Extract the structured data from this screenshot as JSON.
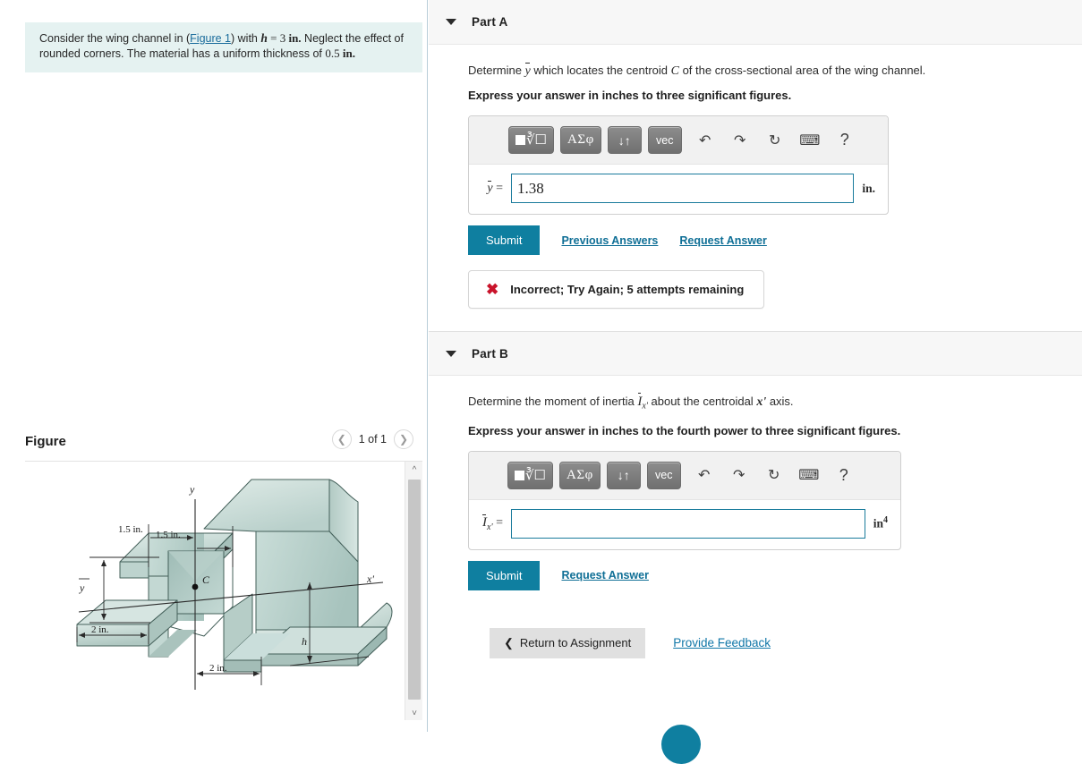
{
  "problem": {
    "text_before_link": "Consider the wing channel in (",
    "figure_link": "Figure 1",
    "text_after_link": ") with ",
    "h_symbol": "h",
    "h_value": " = 3 ",
    "h_unit": "in.",
    "text_mid": " Neglect the effect of rounded corners. The material has a uniform thickness of ",
    "thickness_value": "0.5 ",
    "thickness_unit": "in."
  },
  "figure_panel": {
    "title": "Figure",
    "counter": "1 of 1",
    "prev_icon": "chevron-left-icon",
    "next_icon": "chevron-right-icon",
    "labels": {
      "y_axis": "y",
      "x_prime_axis": "x'",
      "centroid": "C",
      "y_bar": "y",
      "h": "h",
      "dim_1": "1.5 in.",
      "dim_2": "1.5 in.",
      "dim_3": "2 in.",
      "dim_4": "2 in."
    },
    "colors": {
      "body_light": "#d3e3de",
      "body_mid": "#b4ccc6",
      "body_dark": "#9dbab4",
      "outline": "#3f5550"
    }
  },
  "parts": [
    {
      "id": "part-a",
      "title": "Part A",
      "caret_icon": "caret-down-icon",
      "question": {
        "lead": "Determine ",
        "symbol": "y",
        "mid": " which locates the centroid ",
        "symbol2": "C",
        "tail": " of the cross-sectional area of the wing channel."
      },
      "instruction": "Express your answer in inches to three significant figures.",
      "toolbar": {
        "buttons": [
          {
            "name": "math-template-button",
            "label": "√"
          },
          {
            "name": "greek-symbols-button",
            "label": "ΑΣφ"
          },
          {
            "name": "arrows-button",
            "label": "↓↑"
          },
          {
            "name": "vector-button",
            "label": "vec"
          }
        ],
        "icons": [
          {
            "name": "undo-icon",
            "glyph": "↶"
          },
          {
            "name": "redo-icon",
            "glyph": "↷"
          },
          {
            "name": "reset-icon",
            "glyph": "↻"
          },
          {
            "name": "keyboard-icon",
            "glyph": "⌨"
          },
          {
            "name": "help-icon",
            "glyph": "?"
          }
        ]
      },
      "answer": {
        "var_label": "y",
        "equals": " =",
        "value": "1.38",
        "placeholder": "",
        "unit": "in.",
        "unit_sup": ""
      },
      "submit_label": "Submit",
      "links": [
        "Previous Answers",
        "Request Answer"
      ],
      "feedback": {
        "icon": "x-mark-icon",
        "text": "Incorrect; Try Again; 5 attempts remaining"
      }
    },
    {
      "id": "part-b",
      "title": "Part B",
      "caret_icon": "caret-down-icon",
      "question": {
        "lead": "Determine the moment of inertia ",
        "symbol": "I",
        "subscript": "x'",
        "mid": " about the centroidal ",
        "symbol2": "x'",
        "tail": " axis."
      },
      "instruction": "Express your answer in inches to the fourth power to three significant figures.",
      "toolbar": {
        "buttons": [
          {
            "name": "math-template-button",
            "label": "√"
          },
          {
            "name": "greek-symbols-button",
            "label": "ΑΣφ"
          },
          {
            "name": "arrows-button",
            "label": "↓↑"
          },
          {
            "name": "vector-button",
            "label": "vec"
          }
        ],
        "icons": [
          {
            "name": "undo-icon",
            "glyph": "↶"
          },
          {
            "name": "redo-icon",
            "glyph": "↷"
          },
          {
            "name": "reset-icon",
            "glyph": "↻"
          },
          {
            "name": "keyboard-icon",
            "glyph": "⌨"
          },
          {
            "name": "help-icon",
            "glyph": "?"
          }
        ]
      },
      "answer": {
        "var_label": "I",
        "subscript": "x'",
        "equals": " =",
        "value": "",
        "placeholder": "",
        "unit": "in",
        "unit_sup": "4"
      },
      "submit_label": "Submit",
      "links": [
        "Request Answer"
      ],
      "feedback": null
    }
  ],
  "footer": {
    "return_label": "Return to Assignment",
    "return_icon": "chevron-left-icon",
    "feedback_label": "Provide Feedback"
  },
  "colors": {
    "accent_teal": "#0f7fa0",
    "link_blue": "#0f6f96",
    "problem_bg": "#e5f2f1",
    "panel_gray": "#f7f7f7",
    "error_red": "#c9132b"
  }
}
